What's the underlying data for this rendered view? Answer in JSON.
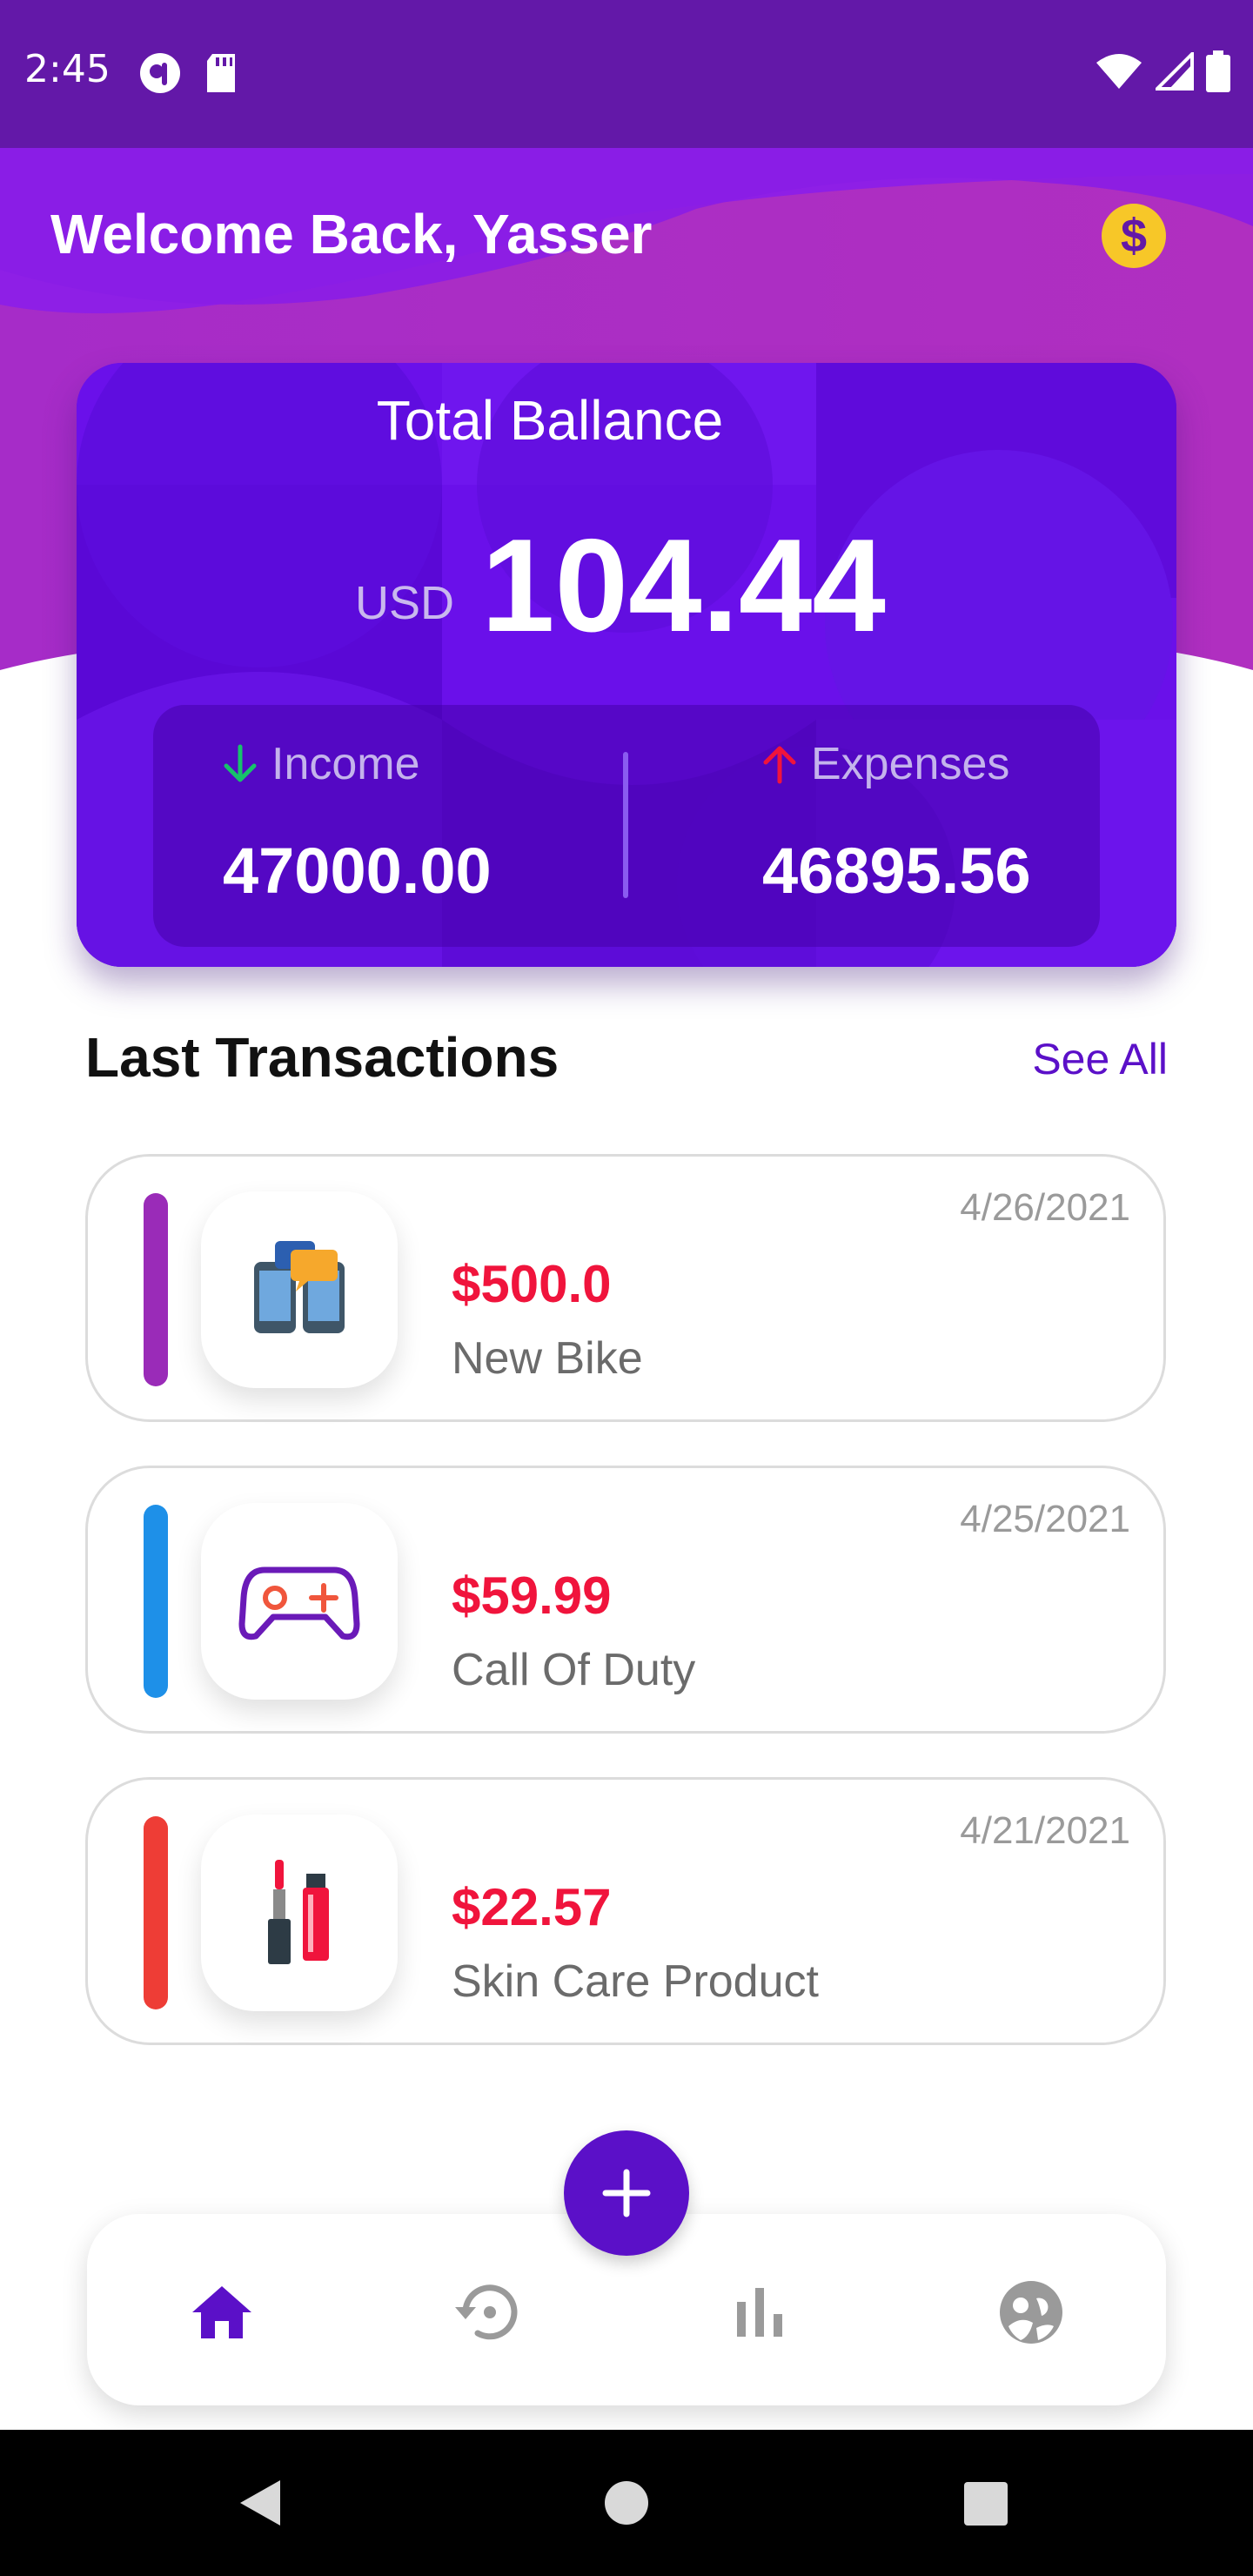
{
  "status_bar": {
    "time": "2:45"
  },
  "header": {
    "welcome": "Welcome Back, Yasser",
    "coin_symbol": "$"
  },
  "balance": {
    "title": "Total Ballance",
    "currency": "USD",
    "amount": "104.44",
    "income_label": "Income",
    "income_value": "47000.00",
    "expenses_label": "Expenses",
    "expenses_value": "46895.56"
  },
  "transactions": {
    "title": "Last Transactions",
    "see_all": "See All",
    "items": [
      {
        "date": "4/26/2021",
        "amount": "$500.0",
        "name": "New Bike",
        "accent": "#9a2bb8",
        "icon": "phones-chat-icon"
      },
      {
        "date": "4/25/2021",
        "amount": "$59.99",
        "name": "Call Of Duty",
        "accent": "#1e90e8",
        "icon": "gamepad-icon"
      },
      {
        "date": "4/21/2021",
        "amount": "$22.57",
        "name": "Skin Care Product",
        "accent": "#ee3d36",
        "icon": "lipstick-icon"
      }
    ]
  },
  "nav": {
    "items": [
      {
        "icon": "home-icon",
        "active": true
      },
      {
        "icon": "history-icon",
        "active": false
      },
      {
        "icon": "bar-chart-icon",
        "active": false
      },
      {
        "icon": "face-icon",
        "active": false
      }
    ],
    "fab_icon": "plus-icon"
  },
  "colors": {
    "primary": "#5b10c8",
    "status_bar": "#6318a8",
    "amount_red": "#f0143c",
    "income_green": "#17c26b",
    "expense_red": "#f0143c"
  }
}
